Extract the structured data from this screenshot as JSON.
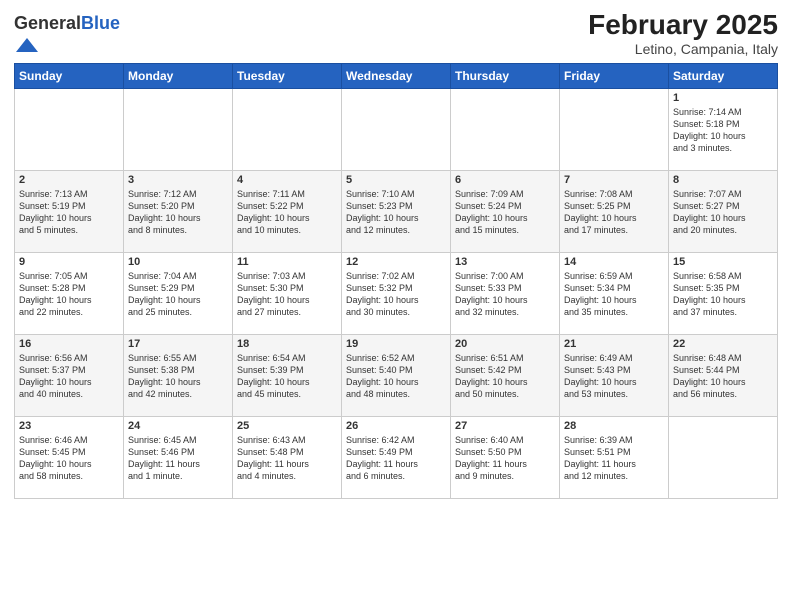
{
  "logo": {
    "general": "General",
    "blue": "Blue"
  },
  "header": {
    "month": "February 2025",
    "location": "Letino, Campania, Italy"
  },
  "weekdays": [
    "Sunday",
    "Monday",
    "Tuesday",
    "Wednesday",
    "Thursday",
    "Friday",
    "Saturday"
  ],
  "weeks": [
    [
      {
        "day": "",
        "info": ""
      },
      {
        "day": "",
        "info": ""
      },
      {
        "day": "",
        "info": ""
      },
      {
        "day": "",
        "info": ""
      },
      {
        "day": "",
        "info": ""
      },
      {
        "day": "",
        "info": ""
      },
      {
        "day": "1",
        "info": "Sunrise: 7:14 AM\nSunset: 5:18 PM\nDaylight: 10 hours\nand 3 minutes."
      }
    ],
    [
      {
        "day": "2",
        "info": "Sunrise: 7:13 AM\nSunset: 5:19 PM\nDaylight: 10 hours\nand 5 minutes."
      },
      {
        "day": "3",
        "info": "Sunrise: 7:12 AM\nSunset: 5:20 PM\nDaylight: 10 hours\nand 8 minutes."
      },
      {
        "day": "4",
        "info": "Sunrise: 7:11 AM\nSunset: 5:22 PM\nDaylight: 10 hours\nand 10 minutes."
      },
      {
        "day": "5",
        "info": "Sunrise: 7:10 AM\nSunset: 5:23 PM\nDaylight: 10 hours\nand 12 minutes."
      },
      {
        "day": "6",
        "info": "Sunrise: 7:09 AM\nSunset: 5:24 PM\nDaylight: 10 hours\nand 15 minutes."
      },
      {
        "day": "7",
        "info": "Sunrise: 7:08 AM\nSunset: 5:25 PM\nDaylight: 10 hours\nand 17 minutes."
      },
      {
        "day": "8",
        "info": "Sunrise: 7:07 AM\nSunset: 5:27 PM\nDaylight: 10 hours\nand 20 minutes."
      }
    ],
    [
      {
        "day": "9",
        "info": "Sunrise: 7:05 AM\nSunset: 5:28 PM\nDaylight: 10 hours\nand 22 minutes."
      },
      {
        "day": "10",
        "info": "Sunrise: 7:04 AM\nSunset: 5:29 PM\nDaylight: 10 hours\nand 25 minutes."
      },
      {
        "day": "11",
        "info": "Sunrise: 7:03 AM\nSunset: 5:30 PM\nDaylight: 10 hours\nand 27 minutes."
      },
      {
        "day": "12",
        "info": "Sunrise: 7:02 AM\nSunset: 5:32 PM\nDaylight: 10 hours\nand 30 minutes."
      },
      {
        "day": "13",
        "info": "Sunrise: 7:00 AM\nSunset: 5:33 PM\nDaylight: 10 hours\nand 32 minutes."
      },
      {
        "day": "14",
        "info": "Sunrise: 6:59 AM\nSunset: 5:34 PM\nDaylight: 10 hours\nand 35 minutes."
      },
      {
        "day": "15",
        "info": "Sunrise: 6:58 AM\nSunset: 5:35 PM\nDaylight: 10 hours\nand 37 minutes."
      }
    ],
    [
      {
        "day": "16",
        "info": "Sunrise: 6:56 AM\nSunset: 5:37 PM\nDaylight: 10 hours\nand 40 minutes."
      },
      {
        "day": "17",
        "info": "Sunrise: 6:55 AM\nSunset: 5:38 PM\nDaylight: 10 hours\nand 42 minutes."
      },
      {
        "day": "18",
        "info": "Sunrise: 6:54 AM\nSunset: 5:39 PM\nDaylight: 10 hours\nand 45 minutes."
      },
      {
        "day": "19",
        "info": "Sunrise: 6:52 AM\nSunset: 5:40 PM\nDaylight: 10 hours\nand 48 minutes."
      },
      {
        "day": "20",
        "info": "Sunrise: 6:51 AM\nSunset: 5:42 PM\nDaylight: 10 hours\nand 50 minutes."
      },
      {
        "day": "21",
        "info": "Sunrise: 6:49 AM\nSunset: 5:43 PM\nDaylight: 10 hours\nand 53 minutes."
      },
      {
        "day": "22",
        "info": "Sunrise: 6:48 AM\nSunset: 5:44 PM\nDaylight: 10 hours\nand 56 minutes."
      }
    ],
    [
      {
        "day": "23",
        "info": "Sunrise: 6:46 AM\nSunset: 5:45 PM\nDaylight: 10 hours\nand 58 minutes."
      },
      {
        "day": "24",
        "info": "Sunrise: 6:45 AM\nSunset: 5:46 PM\nDaylight: 11 hours\nand 1 minute."
      },
      {
        "day": "25",
        "info": "Sunrise: 6:43 AM\nSunset: 5:48 PM\nDaylight: 11 hours\nand 4 minutes."
      },
      {
        "day": "26",
        "info": "Sunrise: 6:42 AM\nSunset: 5:49 PM\nDaylight: 11 hours\nand 6 minutes."
      },
      {
        "day": "27",
        "info": "Sunrise: 6:40 AM\nSunset: 5:50 PM\nDaylight: 11 hours\nand 9 minutes."
      },
      {
        "day": "28",
        "info": "Sunrise: 6:39 AM\nSunset: 5:51 PM\nDaylight: 11 hours\nand 12 minutes."
      },
      {
        "day": "",
        "info": ""
      }
    ]
  ]
}
